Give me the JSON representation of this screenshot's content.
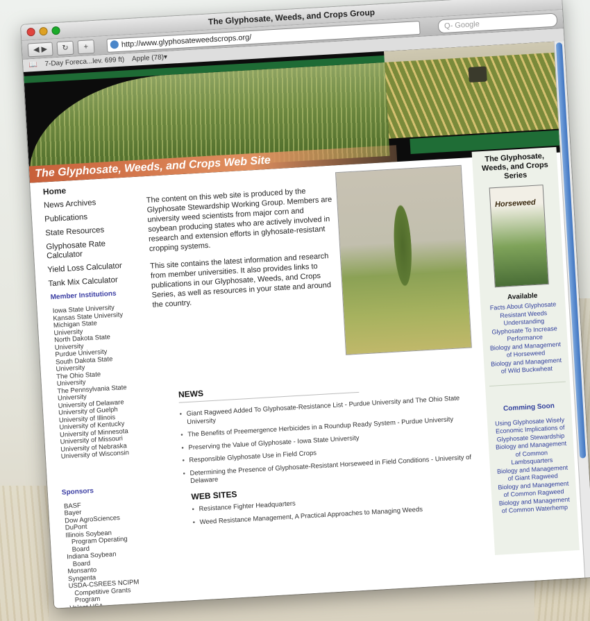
{
  "window": {
    "title": "The Glyphosate, Weeds, and Crops Group",
    "url": "http://www.glyphosateweedscrops.org/",
    "search_placeholder": "Q- Google",
    "bookmarks": [
      "7-Day Foreca...lev. 699 ft)",
      "Apple (78)▾"
    ]
  },
  "banner": {
    "title": "The Glyphosate, Weeds, and Crops Web Site"
  },
  "nav": {
    "items": [
      "Home",
      "News Archives",
      "Publications",
      "State Resources",
      "Glyphosate Rate Calculator",
      "Yield Loss Calculator",
      "Tank Mix Calculator"
    ],
    "members_heading": "Member Institutions",
    "members": [
      "Iowa State University",
      "Kansas State University",
      "Michigan State",
      "University",
      "North Dakota State",
      "University",
      "Purdue University",
      "South Dakota State",
      "University",
      "The Ohio State",
      "University",
      "The Pennsylvania State",
      "University",
      "University of Delaware",
      "University of Guelph",
      "University of Illinois",
      "University of Kentucky",
      "University of Minnesota",
      "University of Missouri",
      "University of Nebraska",
      "University of Wisconsin"
    ],
    "sponsors_heading": "Sponsors",
    "sponsors": [
      "BASF",
      "Bayer",
      "Dow AgroSciences",
      "DuPont",
      "Illinois Soybean",
      "Program Operating",
      "Board",
      "Indiana Soybean",
      "Board",
      "Monsanto",
      "Syngenta",
      "USDA-CSREES NCIPM",
      "Competitive Grants",
      "Program",
      "Valent USA"
    ]
  },
  "intro": {
    "p1": "The content on this web site is produced by the Glyphosate Stewardship Working Group. Members are university weed scientists from major corn and soybean producing states who are actively involved in research and extension efforts in glyhosate-resistant cropping systems.",
    "p2": "This site contains the latest information and research from member universities. It also provides links to publications in our Glyphosate, Weeds, and Crops Series, as well as resources in your state and around the country."
  },
  "news": {
    "heading": "NEWS",
    "items": [
      "Giant Ragweed Added To Glyphosate-Resistance List - Purdue University and The Ohio State University",
      "The Benefits of Preemergence Herbicides in a Roundup Ready System - Purdue University",
      "Preserving the Value of Glyphosate - Iowa State University",
      "Responsible Glyphosate Use in Field Crops",
      "Determining the Presence of Glyphosate-Resistant Horseweed in Field Conditions - University of Delaware"
    ]
  },
  "websites": {
    "heading": "WEB SITES",
    "items": [
      "Resistance Fighter Headquarters",
      "Weed Resistance Management, A Practical Approaches to Managing Weeds"
    ]
  },
  "right": {
    "series_title": "The Glyphosate, Weeds, and Crops Series",
    "book_title": "Horseweed",
    "available_heading": "Available",
    "available": [
      "Facts About Glyphosate",
      "Resistant Weeds",
      "Understanding",
      "Glyphosate To Increase",
      "Performance",
      "Biology and Management",
      "of Horseweed",
      "Biology and Management",
      "of Wild Buckwheat"
    ],
    "soon_heading": "Comming Soon",
    "soon": [
      "Using Glyphosate Wisely",
      "Economic Implications of",
      "Glyphosate Stewardship",
      "Biology and Management",
      "of Common",
      "Lambsquarters",
      "Biology and Management",
      "of Giant Ragweed",
      "Biology and Management",
      "of Common Ragweed",
      "Biology and Management",
      "of Common Waterhemp"
    ]
  }
}
